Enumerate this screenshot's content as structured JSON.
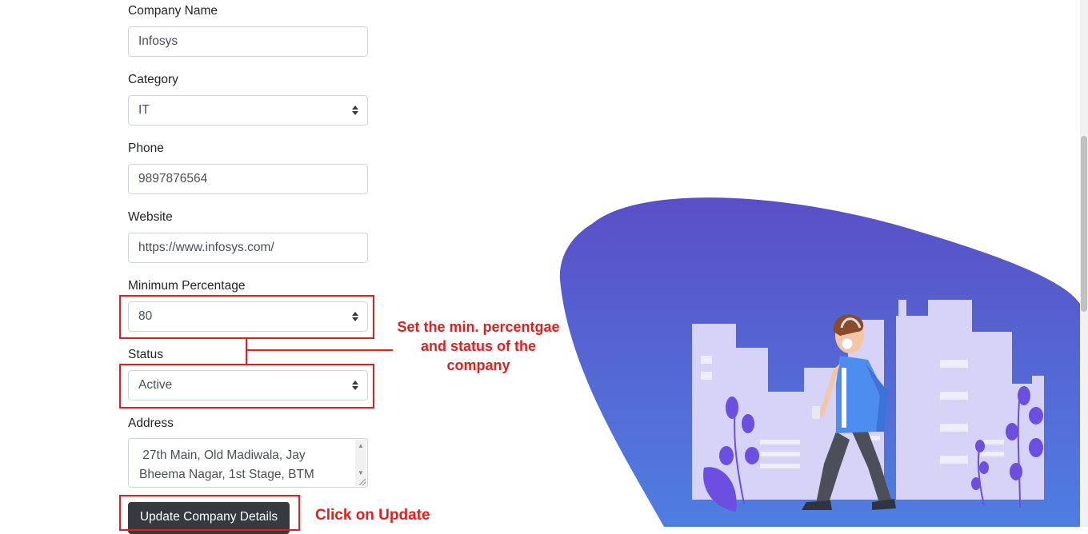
{
  "form": {
    "company_name": {
      "label": "Company Name",
      "value": "Infosys"
    },
    "category": {
      "label": "Category",
      "value": "IT"
    },
    "phone": {
      "label": "Phone",
      "value": "9897876564"
    },
    "website": {
      "label": "Website",
      "value": "https://www.infosys.com/"
    },
    "min_percentage": {
      "label": "Minimum Percentage",
      "value": "80"
    },
    "status": {
      "label": "Status",
      "value": "Active"
    },
    "address": {
      "label": "Address",
      "line1": " 27th Main, Old Madiwala, Jay",
      "line2": "Bheema Nagar, 1st Stage, BTM"
    },
    "submit_label": "Update Company Details"
  },
  "annotations": {
    "percentage_status": {
      "line1": "Set the min. percentgae",
      "line2": "and status of the",
      "line3": "company"
    },
    "update": "Click on Update"
  },
  "colors": {
    "annotation": "#e02020",
    "button": "#343a40",
    "blob_top": "#5a4fc6",
    "blob_bottom": "#4f7ee0",
    "buildings": "#d6d3f7",
    "plants": "#6c4fe0"
  },
  "icons": {
    "select_caret": "select-caret-icon",
    "illustration": "walking-man-city-illustration"
  }
}
